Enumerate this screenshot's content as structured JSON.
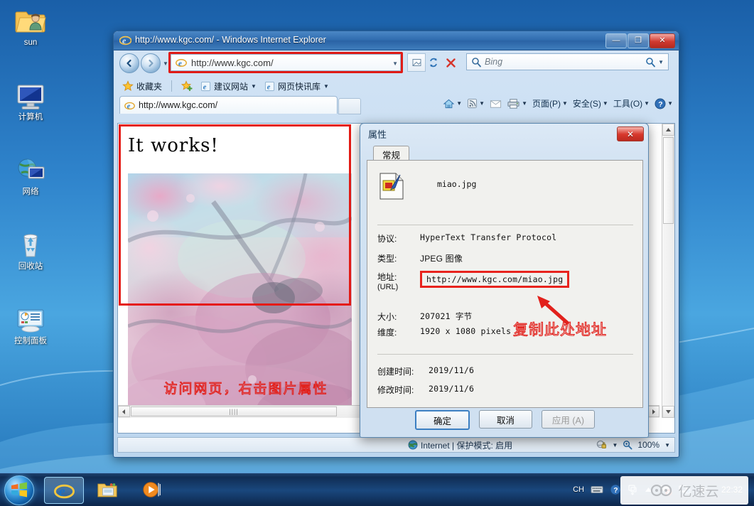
{
  "desktop": {
    "icons": [
      {
        "label": "sun",
        "icon": "folder-user-icon"
      },
      {
        "label": "计算机",
        "icon": "computer-icon"
      },
      {
        "label": "网络",
        "icon": "network-icon"
      },
      {
        "label": "回收站",
        "icon": "recycle-bin-icon"
      },
      {
        "label": "控制面板",
        "icon": "control-panel-icon"
      }
    ]
  },
  "browser": {
    "title": "http://www.kgc.com/ - Windows Internet Explorer",
    "window_buttons": {
      "minimize": "—",
      "maximize": "❐",
      "close": "✕"
    },
    "address": {
      "value": "http://www.kgc.com/",
      "dropdown": "▼"
    },
    "address_buttons": [
      {
        "name": "compatibility-view-button",
        "glyph": "⎙"
      },
      {
        "name": "refresh-button",
        "glyph": "↻"
      },
      {
        "name": "stop-button",
        "glyph": "✕"
      }
    ],
    "search": {
      "placeholder": "Bing",
      "icon": "search-icon"
    },
    "favorites_bar": [
      {
        "label": "收藏夹",
        "icon": "star-icon",
        "caret": false
      },
      {
        "label": "建议网站",
        "icon": "ie-icon",
        "caret": true
      },
      {
        "label": "网页快讯库",
        "icon": "ie-icon",
        "caret": true
      }
    ],
    "tab": {
      "label": "http://www.kgc.com/"
    },
    "command_bar": [
      {
        "label": "",
        "icon": "home-icon",
        "caret": true
      },
      {
        "label": "",
        "icon": "feeds-icon",
        "caret": true
      },
      {
        "label": "",
        "icon": "mail-icon",
        "caret": false
      },
      {
        "label": "",
        "icon": "print-icon",
        "caret": true
      },
      {
        "label": "页面(P)",
        "icon": "",
        "caret": true
      },
      {
        "label": "安全(S)",
        "icon": "",
        "caret": true
      },
      {
        "label": "工具(O)",
        "icon": "",
        "caret": true
      },
      {
        "label": "",
        "icon": "help-icon",
        "caret": true
      }
    ],
    "page": {
      "heading": "It works!",
      "image_annotation": "访问网页，右击图片属性"
    },
    "status": {
      "zone": "Internet | 保护模式: 启用",
      "zoom": "100%",
      "zone_icon": "globe-icon",
      "privacy_icon": "privacy-lock-icon",
      "zoom_icon": "zoom-icon"
    },
    "scroll": {
      "h_grip": "||||"
    }
  },
  "dialog": {
    "title": "属性",
    "close_glyph": "✕",
    "tab_label": "常规",
    "file_name": "miao.jpg",
    "file_icon": "image-file-pen-icon",
    "rows": [
      {
        "label": "协议:",
        "value": "HyperText Transfer Protocol"
      },
      {
        "label": "类型:",
        "value": "JPEG 图像"
      },
      {
        "label": "地址:\n(URL)",
        "value": "http://www.kgc.com/miao.jpg",
        "highlighted": true
      },
      {
        "label": "大小:",
        "value": "207021 字节"
      },
      {
        "label": "维度:",
        "value": "1920  x  1080  pixels"
      },
      {
        "label": "创建时间:",
        "value": "2019/11/6"
      },
      {
        "label": "修改时间:",
        "value": "2019/11/6"
      }
    ],
    "labels": {
      "protocol": "协议:",
      "type": "类型:",
      "address": "地址:",
      "address_sub": "(URL)",
      "size": "大小:",
      "dimensions": "维度:",
      "created": "创建时间:",
      "modified": "修改时间:"
    },
    "values": {
      "protocol": "HyperText Transfer Protocol",
      "type": "JPEG 图像",
      "address": "http://www.kgc.com/miao.jpg",
      "size": "207021 字节",
      "dimensions": "1920  x  1080  pixels",
      "created": "2019/11/6",
      "modified": "2019/11/6"
    },
    "annotation": "复制此处地址",
    "buttons": {
      "ok": "确定",
      "cancel": "取消",
      "apply": "应用 (A)"
    }
  },
  "taskbar": {
    "start": "start-orb",
    "items": [
      {
        "name": "taskbar-ie",
        "icon": "ie-icon",
        "active": true
      },
      {
        "name": "taskbar-explorer",
        "icon": "folder-icon",
        "active": false
      },
      {
        "name": "taskbar-media-player",
        "icon": "media-player-icon",
        "active": false
      }
    ],
    "tray": {
      "ime": "CH",
      "icons": [
        "keyboard-icon",
        "help-icon",
        "ime-switch-icon",
        "show-hidden-icon",
        "action-center-flag-icon",
        "network-icon",
        "volume-icon"
      ],
      "clock": "22:32"
    },
    "watermark": "亿速云"
  },
  "colors": {
    "annotation_red": "#e2211c",
    "highlight_red": "#e8231d",
    "window_blue": "#2f6cae",
    "taskbar_blue": "#0d284f"
  }
}
